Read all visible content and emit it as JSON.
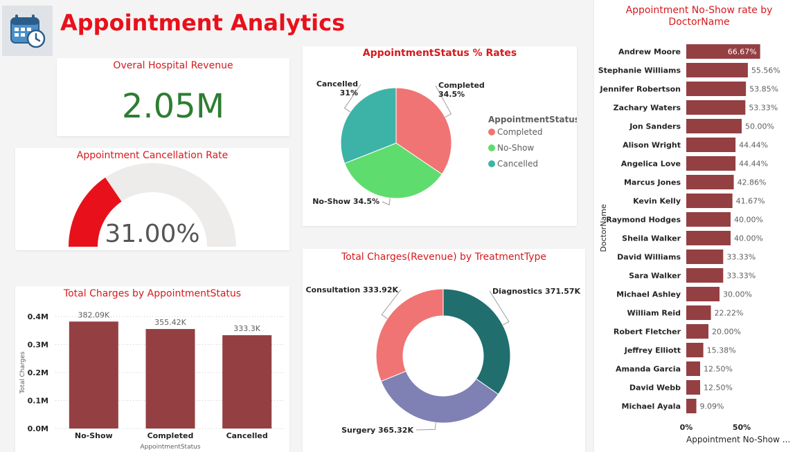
{
  "header": {
    "title": "Appointment Analytics",
    "logo_icon": "calendar-clock-icon"
  },
  "revenue_card": {
    "title": "Overal Hospital Revenue",
    "value": "2.05M",
    "value_color": "#2e7d32"
  },
  "cancellation_card": {
    "title": "Appointment Cancellation Rate",
    "value_label": "31.00%",
    "value": 0.31,
    "fill_color": "#e8111b",
    "track_color": "#eeecea"
  },
  "colors": {
    "title_red": "#d7191c",
    "bar": "#943f42",
    "completed": "#f07474",
    "noshow": "#5fdc6e",
    "cancelled": "#3db3a8",
    "diagnostics": "#216e6e",
    "surgery": "#7f80b4",
    "consultation": "#f07474"
  },
  "chart_data": [
    {
      "type": "pie",
      "title": "AppointmentStatus % Rates",
      "legend_title": "AppointmentStatus",
      "legend_position": "right",
      "slices": [
        {
          "label": "Completed",
          "value": 34.5,
          "value_label": "34.5%",
          "color": "#f07474"
        },
        {
          "label": "No-Show",
          "value": 34.5,
          "value_label": "34.5%",
          "color": "#5fdc6e"
        },
        {
          "label": "Cancelled",
          "value": 31,
          "value_label": "31%",
          "color": "#3db3a8"
        }
      ]
    },
    {
      "type": "pie",
      "subtype": "donut",
      "title": "Total Charges(Revenue) by TreatmentType",
      "slices": [
        {
          "label": "Diagnostics",
          "value": 371.57,
          "value_label": "371.57K",
          "color": "#216e6e"
        },
        {
          "label": "Surgery",
          "value": 365.32,
          "value_label": "365.32K",
          "color": "#7f80b4"
        },
        {
          "label": "Consultation",
          "value": 333.92,
          "value_label": "333.92K",
          "color": "#f07474"
        }
      ]
    },
    {
      "type": "bar",
      "title": "Total Charges by AppointmentStatus",
      "categories": [
        "No-Show",
        "Completed",
        "Cancelled"
      ],
      "values": [
        382.09,
        355.42,
        333.3
      ],
      "value_labels": [
        "382.09K",
        "355.42K",
        "333.3K"
      ],
      "unit": "K",
      "xlabel": "AppointmentStatus",
      "ylabel": "Total Charges",
      "ylim": [
        0,
        400
      ],
      "yticks": [
        0,
        100,
        200,
        300,
        400
      ],
      "ytick_labels": [
        "0.0M",
        "0.1M",
        "0.2M",
        "0.3M",
        "0.4M"
      ],
      "grid": true,
      "color": "#943f42"
    },
    {
      "type": "bar",
      "orientation": "horizontal",
      "title": "Appointment No-Show rate by DoctorName",
      "categories": [
        "Andrew Moore",
        "Stephanie Williams",
        "Jennifer Robertson",
        "Zachary Waters",
        "Jon Sanders",
        "Alison Wright",
        "Angelica Love",
        "Marcus Jones",
        "Kevin Kelly",
        "Raymond Hodges",
        "Sheila Walker",
        "David Williams",
        "Sara Walker",
        "Michael Ashley",
        "William Reid",
        "Robert Fletcher",
        "Jeffrey Elliott",
        "Amanda Garcia",
        "David Webb",
        "Michael Ayala"
      ],
      "values": [
        66.67,
        55.56,
        53.85,
        53.33,
        50.0,
        44.44,
        44.44,
        42.86,
        41.67,
        40.0,
        40.0,
        33.33,
        33.33,
        30.0,
        22.22,
        20.0,
        15.38,
        12.5,
        12.5,
        9.09
      ],
      "value_labels": [
        "66.67%",
        "55.56%",
        "53.85%",
        "53.33%",
        "50.00%",
        "44.44%",
        "44.44%",
        "42.86%",
        "41.67%",
        "40.00%",
        "40.00%",
        "33.33%",
        "33.33%",
        "30.00%",
        "22.22%",
        "20.00%",
        "15.38%",
        "12.50%",
        "12.50%",
        "9.09%"
      ],
      "xlabel": "Appointment No-Show ...",
      "ylabel": "DoctorName",
      "xticks": [
        0,
        50
      ],
      "xtick_labels": [
        "0%",
        "50%"
      ],
      "color": "#943f42"
    }
  ]
}
